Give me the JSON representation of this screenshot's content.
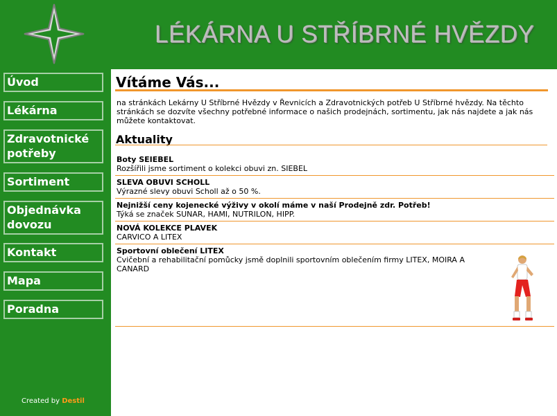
{
  "header": {
    "title": "LÉKÁRNA U STŘÍBRNÉ HVĚZDY",
    "logo_icon": "four-point-star-logo-icon"
  },
  "nav": {
    "items": [
      {
        "label": "Úvod"
      },
      {
        "label": "Lékárna"
      },
      {
        "label": "Zdravotnické potřeby"
      },
      {
        "label": "Sortiment"
      },
      {
        "label": "Objednávka dovozu"
      },
      {
        "label": "Kontakt"
      },
      {
        "label": "Mapa"
      },
      {
        "label": "Poradna"
      }
    ]
  },
  "footer": {
    "created_by": "Created by",
    "brand": "Destil"
  },
  "main": {
    "welcome": "Vítáme Vás...",
    "intro": "na stránkách Lekárny U Stříbrné Hvězdy v Řevnicích a Zdravotnických potřeb U Stříbrné hvězdy. Na těchto stránkách se dozvíte všechny potřebné informace o našich prodejnách, sortimentu, jak nás najdete a jak nás můžete kontaktovat.",
    "news_title": "Aktuality",
    "news": [
      {
        "title": "Boty SEIEBEL",
        "text": "Rozšířili jsme sortiment o kolekci obuvi zn. SIEBEL"
      },
      {
        "title": "SLEVA OBUVI SCHOLL",
        "text": "Výrazné slevy obuvi Scholl až o 50 %."
      },
      {
        "title": "Nejnižší ceny kojenecké výživy v okolí máme v naší Prodejně zdr. Potřeb!",
        "text": "Týká se značek SUNAR, HAMI, NUTRILON, HIPP."
      },
      {
        "title": "NOVÁ KOLEKCE PLAVEK",
        "text": "CARVICO A LITEX"
      },
      {
        "title": "Sportovní oblečení LITEX",
        "text": "Cvičební a rehabilitační pomůcky jsmě doplnili sportovním oblečením firmy LITEX, MOIRA A CANARD"
      }
    ]
  },
  "colors": {
    "green": "#228b22",
    "accent": "#f0962c",
    "nav_border": "#a7d0a7"
  }
}
